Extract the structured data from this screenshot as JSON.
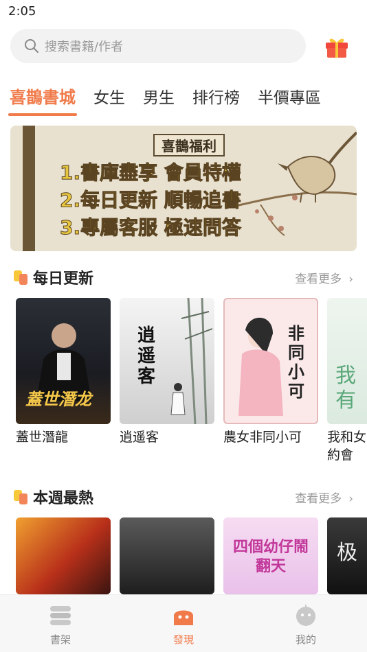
{
  "status_bar": {
    "time": "2:05"
  },
  "search": {
    "placeholder": "搜索書籍/作者"
  },
  "tabs": [
    {
      "label": "喜鵲書城",
      "active": true
    },
    {
      "label": "女生"
    },
    {
      "label": "男生"
    },
    {
      "label": "排行榜"
    },
    {
      "label": "半價專區"
    }
  ],
  "banner": {
    "title": "喜鵲福利",
    "lines": [
      "1.書庫盡享 會員特權",
      "2.每日更新 順暢追書",
      "3.專屬客服 極速問答"
    ]
  },
  "sections": [
    {
      "title": "每日更新",
      "more_label": "查看更多",
      "books": [
        {
          "title": "蓋世潛龍",
          "cover_text": "蓋世潛龙"
        },
        {
          "title": "逍遥客",
          "cover_text": "逍遥客"
        },
        {
          "title": "農女非同小可",
          "cover_text": "非同小可"
        },
        {
          "title": "我和女",
          "title2": "約會",
          "cover_text": "我有"
        }
      ]
    },
    {
      "title": "本週最熱",
      "more_label": "查看更多",
      "books": [
        {
          "title": ""
        },
        {
          "title": ""
        },
        {
          "title": "",
          "cover_text": "四個幼仔鬧翻天"
        },
        {
          "title": "",
          "cover_text": "极"
        }
      ]
    }
  ],
  "bottom_nav": [
    {
      "label": "書架",
      "icon": "bookshelf-icon"
    },
    {
      "label": "發現",
      "icon": "discover-icon",
      "active": true
    },
    {
      "label": "我的",
      "icon": "profile-icon"
    }
  ],
  "colors": {
    "accent": "#f07a4a",
    "muted": "#999999",
    "background": "#ffffff"
  }
}
